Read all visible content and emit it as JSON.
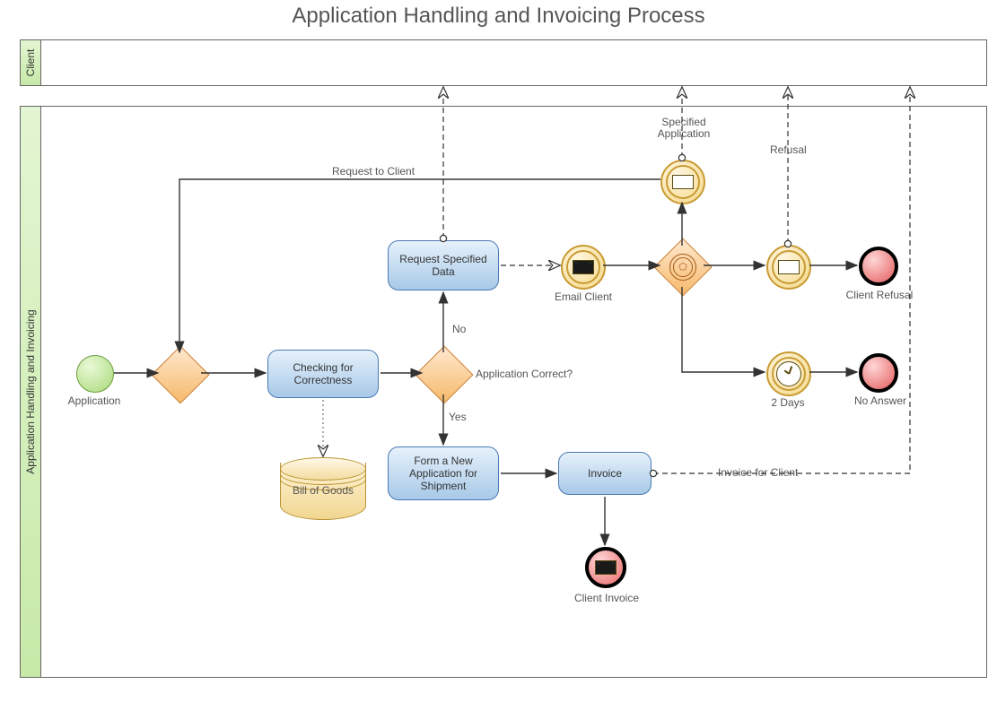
{
  "title": "Application Handling and Invoicing Process",
  "pools": {
    "client": "Client",
    "main": "Application Handling and Invoicing"
  },
  "nodes": {
    "start": "Application",
    "check": "Checking for Correctness",
    "reqSpec": "Request Specified Data",
    "formShip": "Form a New Application for Shipment",
    "invoice": "Invoice",
    "billGoods": "Bill of Goods",
    "emailClient": "Email Client",
    "twoDays": "2 Days",
    "clientRefusal": "Client Refusal",
    "noAnswer": "No Answer",
    "clientInvoice": "Client Invoice"
  },
  "labels": {
    "gatewayQ": "Application Correct?",
    "no": "No",
    "yes": "Yes",
    "reqToClient": "Request to Client",
    "specApp": "Specified Application",
    "refusal": "Refusal",
    "invoiceForClient": "Invoice for Client"
  }
}
